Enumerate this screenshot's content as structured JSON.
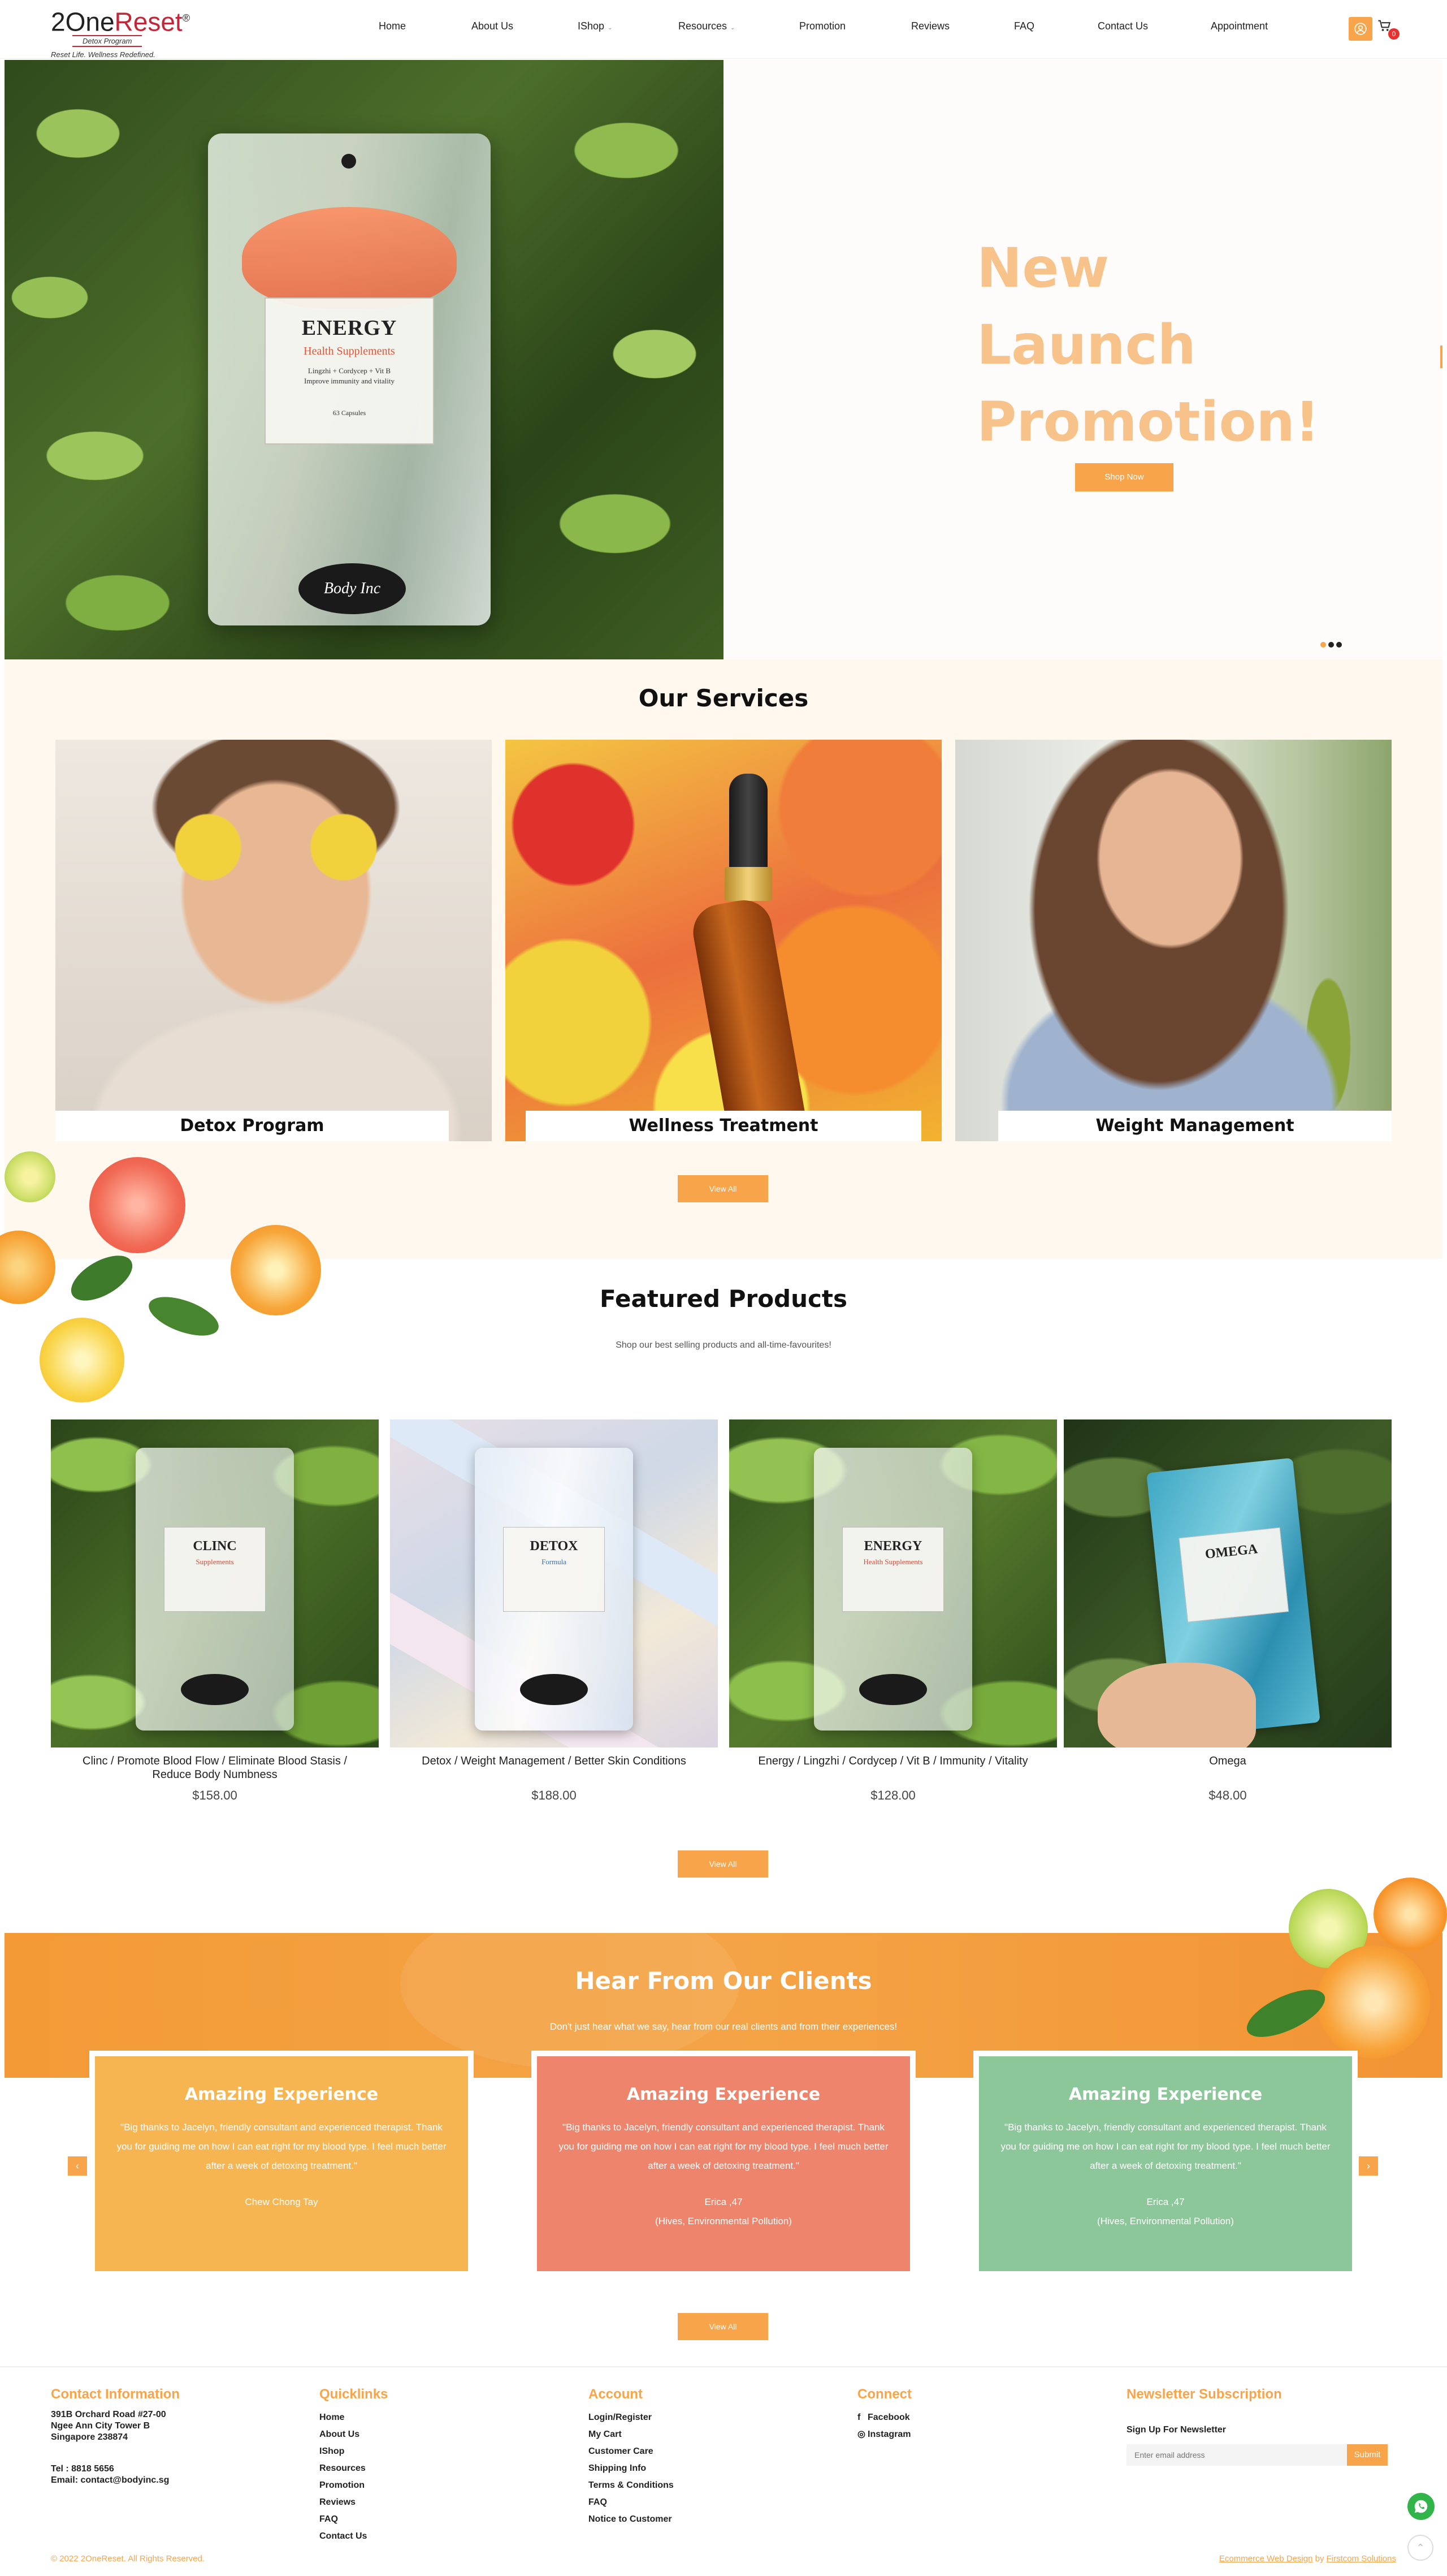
{
  "brand": {
    "logo_main": "2One",
    "logo_accent": "Reset",
    "logo_reg": "®",
    "logo_sub": "Detox Program",
    "tagline": "Reset Life. Wellness Redefined."
  },
  "nav": {
    "items": [
      "Home",
      "About Us",
      "IShop",
      "Resources",
      "Promotion",
      "Reviews",
      "FAQ",
      "Contact Us",
      "Appointment"
    ],
    "caret": "⌄",
    "cart_count": "0"
  },
  "hero": {
    "title_line1": "New",
    "title_line2": "Launch",
    "title_line3": "Promotion!",
    "button": "Shop Now",
    "pouch_title": "ENERGY",
    "pouch_subtitle": "Health Supplements",
    "pouch_text1": "Lingzhi + Cordycep + Vit B",
    "pouch_text2": "Improve immunity and vitality",
    "pouch_text3": "63 Capsules",
    "pouch_brand": "Body Inc"
  },
  "services": {
    "title": "Our Services",
    "cards": [
      {
        "label": "Detox Program"
      },
      {
        "label": "Wellness Treatment"
      },
      {
        "label": "Weight Management"
      }
    ],
    "button": "View All"
  },
  "featured": {
    "title": "Featured Products",
    "subtitle": "Shop our best selling products and all-time-favourites!",
    "products": [
      {
        "name": "Clinc / Promote Blood Flow / Eliminate Blood Stasis / Reduce Body Numbness",
        "price": "$158.00",
        "pouch": "CLINC",
        "pouch_sub": "Supplements"
      },
      {
        "name": "Detox / Weight Management / Better Skin Conditions",
        "price": "$188.00",
        "pouch": "DETOX",
        "pouch_sub": "Formula"
      },
      {
        "name": "Energy / Lingzhi / Cordycep / Vit B / Immunity / Vitality",
        "price": "$128.00",
        "pouch": "ENERGY",
        "pouch_sub": "Health Supplements"
      },
      {
        "name": "Omega",
        "price": "$48.00",
        "pouch": "OMEGA",
        "pouch_sub": ""
      }
    ],
    "button": "View All"
  },
  "testimonials": {
    "title": "Hear From Our Clients",
    "subtitle": "Don't just hear what we say, hear from our real clients and from their experiences!",
    "cards": [
      {
        "title": "Amazing Experience",
        "body": "\"Big thanks to Jacelyn, friendly consultant and experienced therapist. Thank you for guiding me on how I can eat right for my blood type. I feel much better after a week of detoxing treatment.\"",
        "name": "Chew Chong Tay",
        "detail": "",
        "color": "#f7b552"
      },
      {
        "title": "Amazing Experience",
        "body": "\"Big thanks to Jacelyn, friendly consultant and experienced therapist. Thank you for guiding me on how I can eat right for my blood type. I feel much better after a week of detoxing treatment.\"",
        "name": "Erica ,47",
        "detail": "(Hives, Environmental Pollution)",
        "color": "#ee846b"
      },
      {
        "title": "Amazing Experience",
        "body": "\"Big thanks to Jacelyn, friendly consultant and experienced therapist. Thank you for guiding me on how I can eat right for my blood type. I feel much better after a week of detoxing treatment.\"",
        "name": "Erica ,47",
        "detail": "(Hives, Environmental Pollution)",
        "color": "#8cc79a"
      }
    ],
    "prev": "‹",
    "next": "›",
    "button": "View All"
  },
  "footer": {
    "contact": {
      "heading": "Contact Information",
      "line1": "391B Orchard Road #27-00",
      "line2": "Ngee Ann City Tower B",
      "line3": "Singapore 238874",
      "tel": "Tel : 8818 5656",
      "email": "Email: contact@bodyinc.sg"
    },
    "quicklinks": {
      "heading": "Quicklinks",
      "items": [
        "Home",
        "About Us",
        "IShop",
        "Resources",
        "Promotion",
        "Reviews",
        "FAQ",
        "Contact Us"
      ]
    },
    "account": {
      "heading": "Account",
      "items": [
        "Login/Register",
        "My Cart",
        "Customer Care",
        "Shipping Info",
        "Terms & Conditions",
        "FAQ",
        "Notice to Customer"
      ]
    },
    "connect": {
      "heading": "Connect",
      "facebook": "Facebook",
      "instagram": "Instagram"
    },
    "newsletter": {
      "heading": "Newsletter Subscription",
      "label": "Sign Up For Newsletter",
      "placeholder": "Enter email address",
      "button": "Submit"
    },
    "copyright": "© 2022 2OneReset. All Rights Reserved.",
    "credit_prefix": "Ecommerce Web Design",
    "credit_by": " by ",
    "credit_company": "Firstcom Solutions"
  },
  "colors": {
    "accent": "#f7a44a",
    "brand_red": "#c0283a",
    "hero_title": "#f7c38a",
    "services_bg": "#fff8ef"
  }
}
